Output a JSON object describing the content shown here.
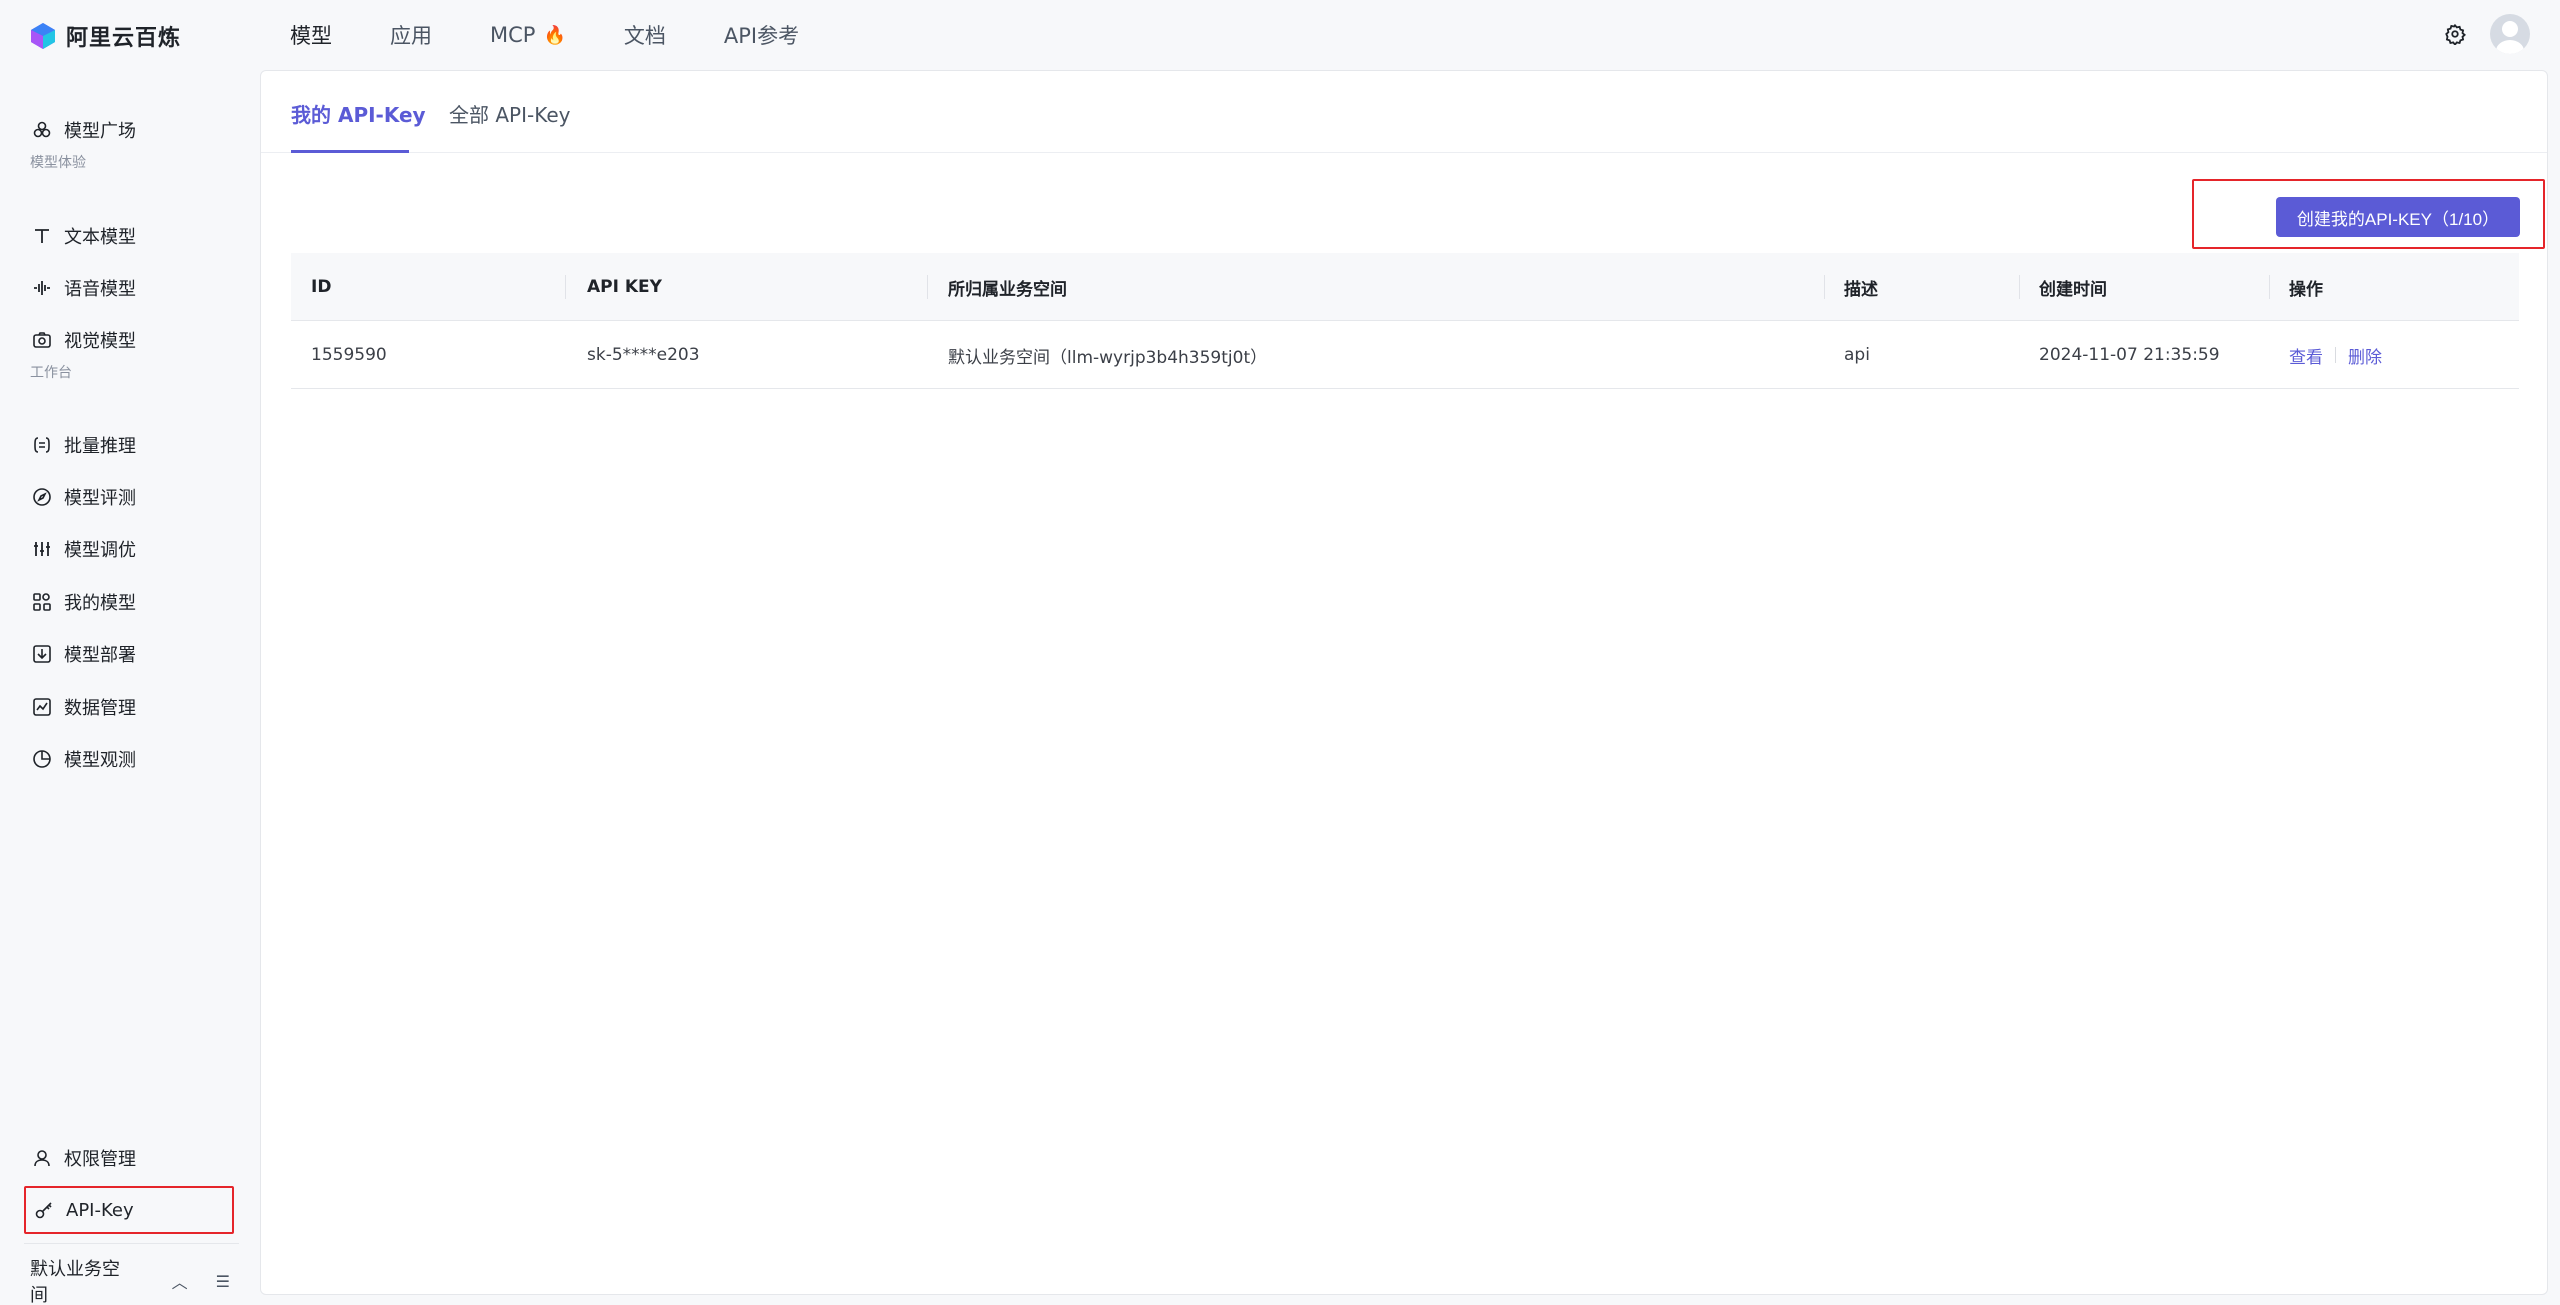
{
  "brand": {
    "name": "阿里云百炼"
  },
  "topnav": {
    "items": [
      {
        "label": "模型",
        "active": true
      },
      {
        "label": "应用"
      },
      {
        "label": "MCP",
        "badge_icon": "flame-icon"
      },
      {
        "label": "文档"
      },
      {
        "label": "API参考"
      }
    ]
  },
  "sidebar": {
    "items": [
      {
        "label": "模型广场",
        "icon": "model-square-icon"
      },
      {
        "group": "模型体验"
      },
      {
        "label": "文本模型",
        "icon": "text-icon"
      },
      {
        "label": "语音模型",
        "icon": "audio-wave-icon"
      },
      {
        "label": "视觉模型",
        "icon": "camera-icon"
      },
      {
        "group": "工作台"
      },
      {
        "label": "批量推理",
        "icon": "batch-icon"
      },
      {
        "label": "模型评测",
        "icon": "compass-icon"
      },
      {
        "label": "模型调优",
        "icon": "sliders-icon"
      },
      {
        "label": "我的模型",
        "icon": "grid-icon"
      },
      {
        "label": "模型部署",
        "icon": "deploy-icon"
      },
      {
        "label": "数据管理",
        "icon": "chart-icon"
      },
      {
        "label": "模型观测",
        "icon": "pie-icon"
      },
      {
        "label": "权限管理",
        "icon": "user-icon"
      },
      {
        "label": "API-Key",
        "icon": "key-icon",
        "highlighted": true
      }
    ],
    "workspace": "默认业务空间"
  },
  "tabs": [
    {
      "label": "我的 API-Key",
      "active": true
    },
    {
      "label": "全部 API-Key"
    }
  ],
  "actions": {
    "create_label": "创建我的API-KEY（1/10）"
  },
  "table": {
    "headers": [
      "ID",
      "API KEY",
      "所归属业务空间",
      "描述",
      "创建时间",
      "操作"
    ],
    "rows": [
      {
        "id": "1559590",
        "api_key": "sk-5****e203",
        "workspace": "默认业务空间（llm-wyrjp3b4h359tj0t）",
        "description": "api",
        "created": "2024-11-07 21:35:59",
        "actions": [
          "查看",
          "删除"
        ]
      }
    ]
  },
  "colors": {
    "accent": "#5b5bd6",
    "highlight_border": "#e5252a"
  }
}
